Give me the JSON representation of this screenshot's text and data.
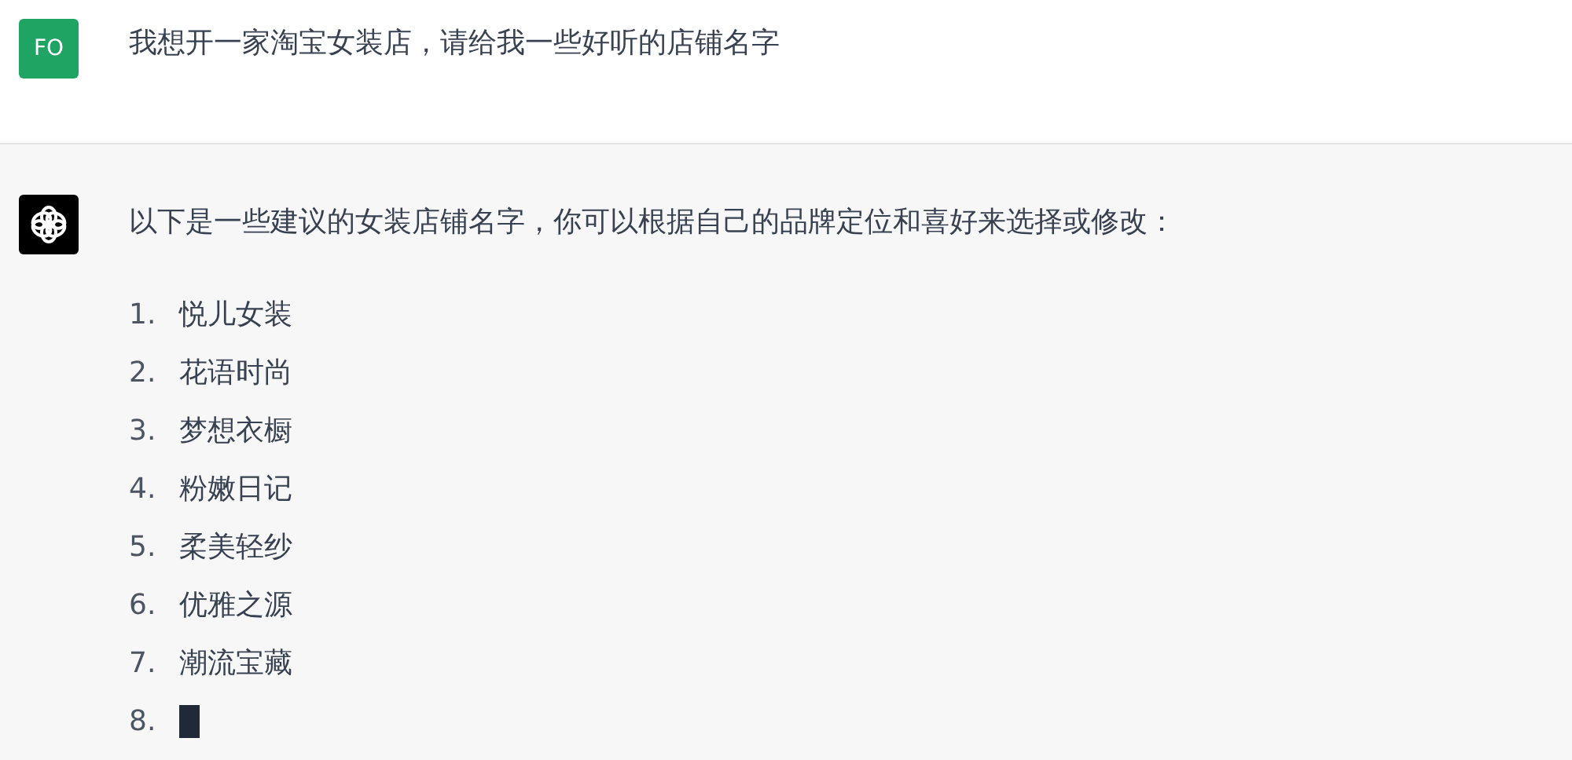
{
  "messages": [
    {
      "kind": "user",
      "avatar": "FO",
      "text": "我想开一家淘宝女装店，请给我一些好听的店铺名字"
    },
    {
      "kind": "assistant",
      "text": "以下是一些建议的女装店铺名字，你可以根据自己的品牌定位和喜好来选择或修改：",
      "typing_cursor": true,
      "list": [
        {
          "number": "1.",
          "text": "悦儿女装"
        },
        {
          "number": "2.",
          "text": "花语时尚"
        },
        {
          "number": "3.",
          "text": "梦想衣橱"
        },
        {
          "number": "4.",
          "text": "粉嫩日记"
        },
        {
          "number": "5.",
          "text": "柔美轻纱"
        },
        {
          "number": "6.",
          "text": "优雅之源"
        },
        {
          "number": "7.",
          "text": "潮流宝藏"
        },
        {
          "number": "8."
        }
      ]
    }
  ]
}
